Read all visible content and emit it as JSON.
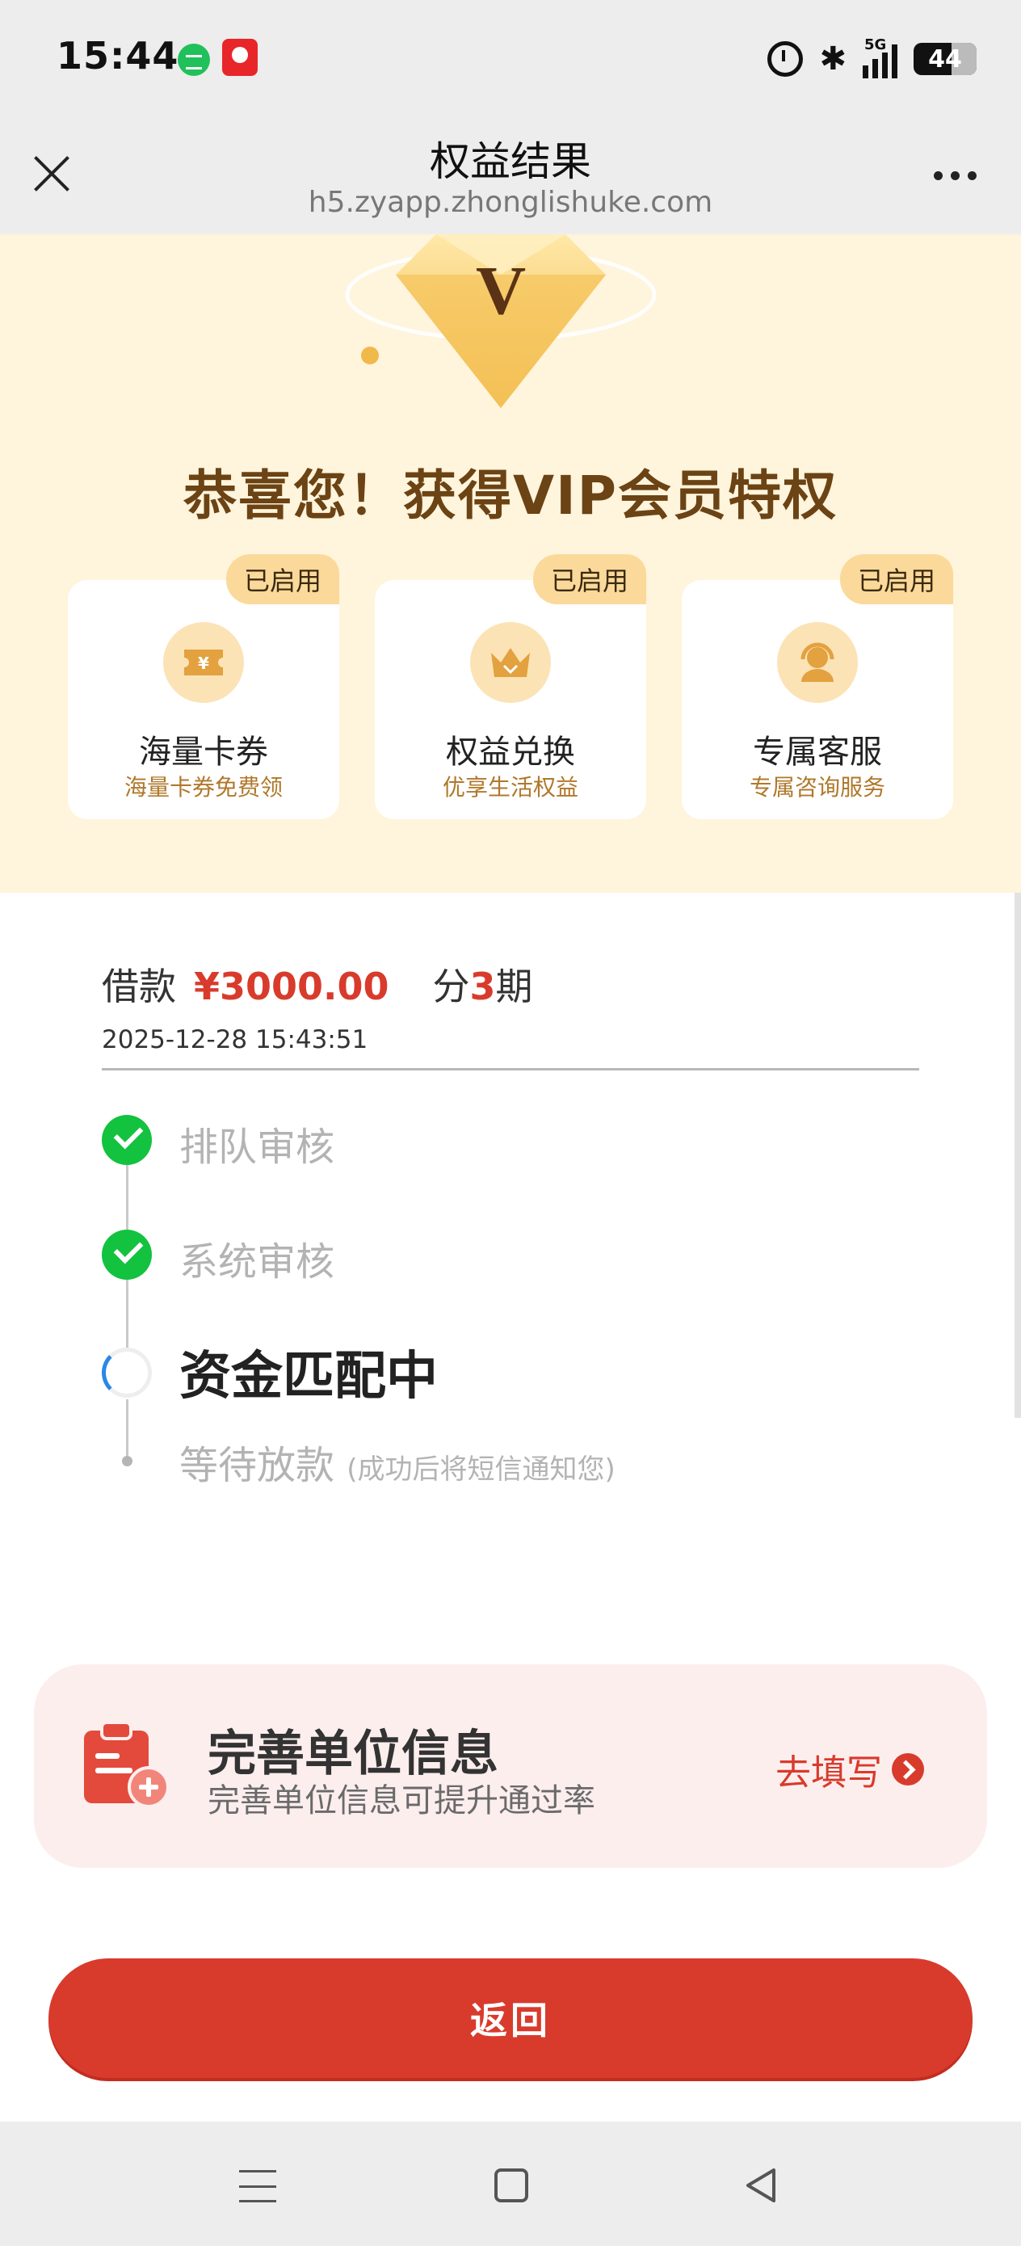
{
  "status_bar": {
    "time": "15:44",
    "network": "5G",
    "battery": "44"
  },
  "nav": {
    "title": "权益结果",
    "url": "h5.zyapp.zhonglishuke.com"
  },
  "hero": {
    "badge_letter": "V",
    "title": "恭喜您！获得VIP会员特权",
    "benefits": [
      {
        "badge": "已启用",
        "icon": "ticket-icon",
        "name": "海量卡券",
        "desc": "海量卡券免费领"
      },
      {
        "badge": "已启用",
        "icon": "crown-icon",
        "name": "权益兑换",
        "desc": "优享生活权益"
      },
      {
        "badge": "已启用",
        "icon": "headset-icon",
        "name": "专属客服",
        "desc": "专属咨询服务"
      }
    ]
  },
  "loan": {
    "label": "借款",
    "amount": "¥3000.00",
    "period_prefix": "分",
    "period_num": "3",
    "period_suffix": "期",
    "date": "2025-12-28 15:43:51"
  },
  "steps": [
    {
      "label": "排队审核",
      "status": "done"
    },
    {
      "label": "系统审核",
      "status": "done"
    },
    {
      "label": "资金匹配中",
      "status": "active"
    },
    {
      "label": "等待放款",
      "note": "(成功后将短信通知您)",
      "status": "pending"
    }
  ],
  "promo": {
    "title": "完善单位信息",
    "subtitle": "完善单位信息可提升通过率",
    "action": "去填写"
  },
  "back_button": "返回",
  "colors": {
    "accent": "#d83b2c",
    "gold": "#6b4314",
    "hero_bg": "#fff4dc",
    "success": "#13c23f",
    "promo_bg": "#fdeeee"
  }
}
